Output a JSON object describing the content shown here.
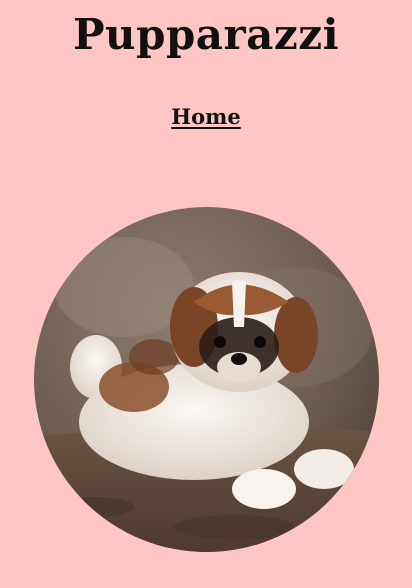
{
  "header": {
    "title": "Pupparazzi"
  },
  "nav": {
    "items": [
      {
        "label": "Home"
      }
    ]
  },
  "main": {
    "photo": {
      "subject": "puppy-photo",
      "colors": {
        "background": "#ffc6c3",
        "rock": "#7b6a5e",
        "fur_white": "#f4efea",
        "fur_brown": "#8a4f2b",
        "fur_dark": "#2b1d18"
      }
    }
  }
}
